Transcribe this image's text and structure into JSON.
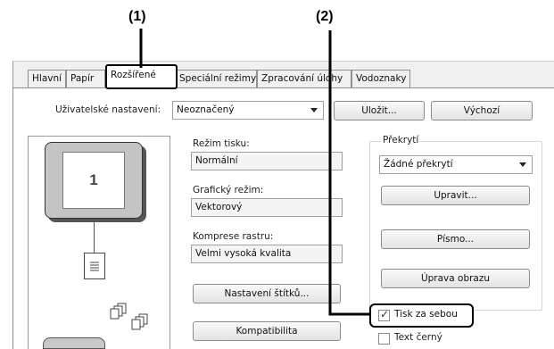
{
  "callouts": {
    "one": "(1)",
    "two": "(2)"
  },
  "tabs": [
    {
      "label": "Hlavní"
    },
    {
      "label": "Papír"
    },
    {
      "label": "Rozšířené",
      "active": true
    },
    {
      "label": "Speciální režimy"
    },
    {
      "label": "Zpracování úlohy"
    },
    {
      "label": "Vodoznaky"
    }
  ],
  "user_settings": {
    "label": "Uživatelské nastavení:",
    "value": "Neoznačený",
    "save_button": "Uložit...",
    "default_button": "Výchozí"
  },
  "preview": {
    "page_number": "1"
  },
  "print_mode": {
    "label": "Režim tisku:",
    "value": "Normální"
  },
  "graphics_mode": {
    "label": "Grafický režim:",
    "value": "Vektorový"
  },
  "raster_compression": {
    "label": "Komprese rastru:",
    "value": "Velmi vysoká kvalita"
  },
  "tab_settings_button": "Nastavení štítků...",
  "compatibility_button": "Kompatibilita",
  "overlay": {
    "label": "Překrytí",
    "value": "Žádné překrytí",
    "edit_button": "Upravit..."
  },
  "font_button": "Písmo...",
  "image_adjust_button": "Úprava obrazu",
  "checkboxes": {
    "sequential_print": {
      "label": "Tisk za sebou",
      "checked": true
    },
    "black_text": {
      "label": "Text černý",
      "checked": false
    }
  }
}
